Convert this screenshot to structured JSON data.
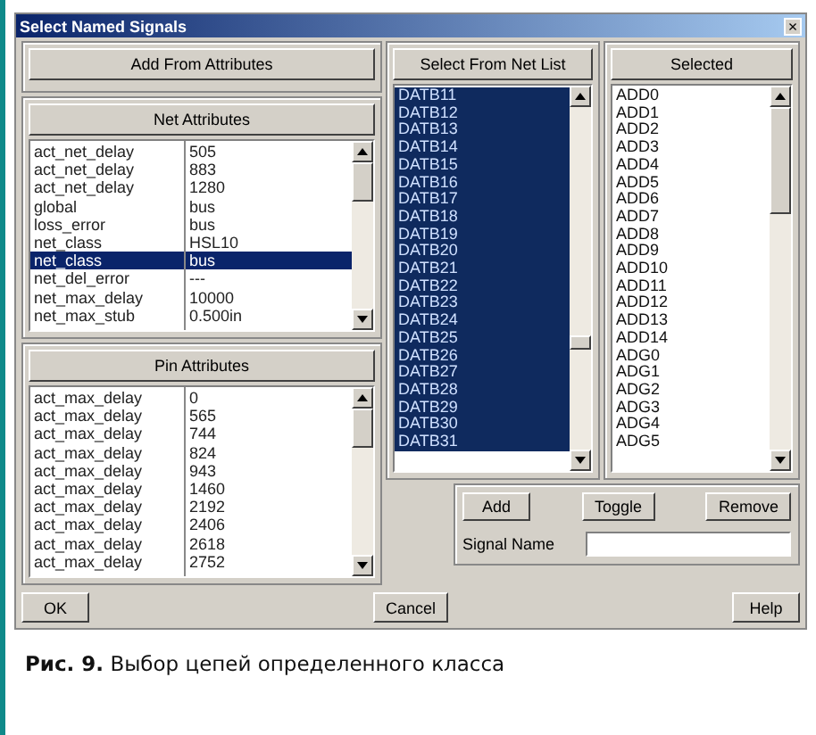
{
  "window": {
    "title": "Select Named Signals",
    "close": "×"
  },
  "add_from_attributes_button": "Add From Attributes",
  "net_attributes": {
    "header": "Net Attributes",
    "rows": [
      {
        "name": "act_net_delay",
        "value": "505",
        "selected": false
      },
      {
        "name": "act_net_delay",
        "value": "883",
        "selected": false
      },
      {
        "name": "act_net_delay",
        "value": "1280",
        "selected": false
      },
      {
        "name": "global",
        "value": "bus",
        "selected": false
      },
      {
        "name": "loss_error",
        "value": "bus",
        "selected": false
      },
      {
        "name": "net_class",
        "value": "HSL10",
        "selected": false
      },
      {
        "name": "net_class",
        "value": "bus",
        "selected": true
      },
      {
        "name": "net_del_error",
        "value": "---",
        "selected": false
      },
      {
        "name": "net_max_delay",
        "value": "10000",
        "selected": false
      },
      {
        "name": "net_max_stub",
        "value": "0.500in",
        "selected": false
      }
    ]
  },
  "pin_attributes": {
    "header": "Pin Attributes",
    "rows": [
      {
        "name": "act_max_delay",
        "value": "0",
        "selected": false
      },
      {
        "name": "act_max_delay",
        "value": "565",
        "selected": false
      },
      {
        "name": "act_max_delay",
        "value": "744",
        "selected": false
      },
      {
        "name": "act_max_delay",
        "value": "824",
        "selected": false
      },
      {
        "name": "act_max_delay",
        "value": "943",
        "selected": false
      },
      {
        "name": "act_max_delay",
        "value": "1460",
        "selected": false
      },
      {
        "name": "act_max_delay",
        "value": "2192",
        "selected": false
      },
      {
        "name": "act_max_delay",
        "value": "2406",
        "selected": false
      },
      {
        "name": "act_max_delay",
        "value": "2618",
        "selected": false
      },
      {
        "name": "act_max_delay",
        "value": "2752",
        "selected": false
      }
    ]
  },
  "net_list": {
    "header": "Select From Net List",
    "items": [
      {
        "label": "DATB11",
        "selected": true
      },
      {
        "label": "DATB12",
        "selected": true
      },
      {
        "label": "DATB13",
        "selected": true
      },
      {
        "label": "DATB14",
        "selected": true
      },
      {
        "label": "DATB15",
        "selected": true
      },
      {
        "label": "DATB16",
        "selected": true
      },
      {
        "label": "DATB17",
        "selected": true
      },
      {
        "label": "DATB18",
        "selected": true
      },
      {
        "label": "DATB19",
        "selected": true
      },
      {
        "label": "DATB20",
        "selected": true
      },
      {
        "label": "DATB21",
        "selected": true
      },
      {
        "label": "DATB22",
        "selected": true
      },
      {
        "label": "DATB23",
        "selected": true
      },
      {
        "label": "DATB24",
        "selected": true
      },
      {
        "label": "DATB25",
        "selected": true
      },
      {
        "label": "DATB26",
        "selected": true
      },
      {
        "label": "DATB27",
        "selected": true
      },
      {
        "label": "DATB28",
        "selected": true
      },
      {
        "label": "DATB29",
        "selected": true
      },
      {
        "label": "DATB30",
        "selected": true
      },
      {
        "label": "DATB31",
        "selected": true
      }
    ]
  },
  "selected_list": {
    "header": "Selected",
    "items": [
      {
        "label": "ADD0",
        "selected": false
      },
      {
        "label": "ADD1",
        "selected": false
      },
      {
        "label": "ADD2",
        "selected": false
      },
      {
        "label": "ADD3",
        "selected": false
      },
      {
        "label": "ADD4",
        "selected": false
      },
      {
        "label": "ADD5",
        "selected": false
      },
      {
        "label": "ADD6",
        "selected": false
      },
      {
        "label": "ADD7",
        "selected": false
      },
      {
        "label": "ADD8",
        "selected": false
      },
      {
        "label": "ADD9",
        "selected": false
      },
      {
        "label": "ADD10",
        "selected": false
      },
      {
        "label": "ADD11",
        "selected": false
      },
      {
        "label": "ADD12",
        "selected": false
      },
      {
        "label": "ADD13",
        "selected": false
      },
      {
        "label": "ADD14",
        "selected": false
      },
      {
        "label": "ADG0",
        "selected": false
      },
      {
        "label": "ADG1",
        "selected": false
      },
      {
        "label": "ADG2",
        "selected": false
      },
      {
        "label": "ADG3",
        "selected": false
      },
      {
        "label": "ADG4",
        "selected": false
      },
      {
        "label": "ADG5",
        "selected": false
      }
    ]
  },
  "actions": {
    "add": "Add",
    "toggle": "Toggle",
    "remove": "Remove",
    "signal_name_label": "Signal Name"
  },
  "footer_buttons": {
    "ok": "OK",
    "cancel": "Cancel",
    "help": "Help"
  },
  "caption": {
    "number": "Рис. 9.",
    "text": "Выбор цепей определенного класса"
  }
}
